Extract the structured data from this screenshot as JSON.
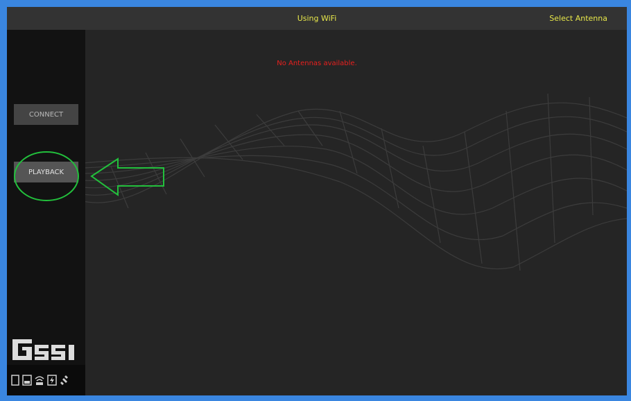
{
  "topbar": {
    "connection_status": "Using WiFi",
    "select_antenna_label": "Select Antenna"
  },
  "main": {
    "message": "No Antennas available."
  },
  "sidebar": {
    "connect_label": "CONNECT",
    "playback_label": "PLAYBACK",
    "logo_text": "GSSI"
  },
  "status_icons": [
    "battery-empty-icon",
    "battery-icon",
    "wifi-icon",
    "power-icon",
    "satellite-icon"
  ],
  "colors": {
    "accent_text": "#e8e84a",
    "error_text": "#e8201e",
    "annotation": "#22c03c",
    "border": "#3a86e0"
  }
}
